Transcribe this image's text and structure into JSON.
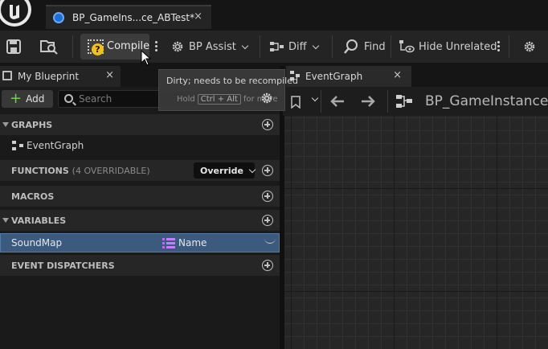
{
  "document_tab": {
    "title": "BP_GameIns...ce_ABTest*",
    "close": "×"
  },
  "toolbar": {
    "compile_label": "Compile",
    "bp_assist_label": "BP Assist",
    "diff_label": "Diff",
    "find_label": "Find",
    "hide_unrelated_label": "Hide Unrelated"
  },
  "tooltip": {
    "line1": "Dirty; needs to be recompiled",
    "hold": "Hold",
    "shortcut": "Ctrl + Alt",
    "rest": "for more"
  },
  "my_blueprint": {
    "tab_label": "My Blueprint",
    "close": "×",
    "add_label": "Add",
    "search_placeholder": "Search",
    "graphs_title": "GRAPHS",
    "event_graph_item": "EventGraph",
    "functions_title": "FUNCTIONS",
    "functions_sub": "(4 OVERRIDABLE)",
    "override_label": "Override",
    "macros_title": "MACROS",
    "variables_title": "VARIABLES",
    "variable": {
      "name": "SoundMap",
      "type": "Name"
    },
    "dispatchers_title": "EVENT DISPATCHERS"
  },
  "graph_panel": {
    "tab_label": "EventGraph",
    "close": "×",
    "breadcrumb": "BP_GameInstance"
  },
  "icons": {
    "save": "save-icon",
    "browse": "browse-icon",
    "compile": "compile-icon",
    "bp_assist": "gear-icon",
    "diff": "diff-icon",
    "find": "find-icon",
    "hide_unrelated": "hide-unrelated-icon",
    "settings": "gear-icon"
  },
  "colors": {
    "bp_tab_dot": "#1d6fd8",
    "compile_warning": "#f2c01a",
    "add_plus": "#6fd04a",
    "selected_row": "#3c5a7e",
    "name_type": "#c87bff"
  }
}
